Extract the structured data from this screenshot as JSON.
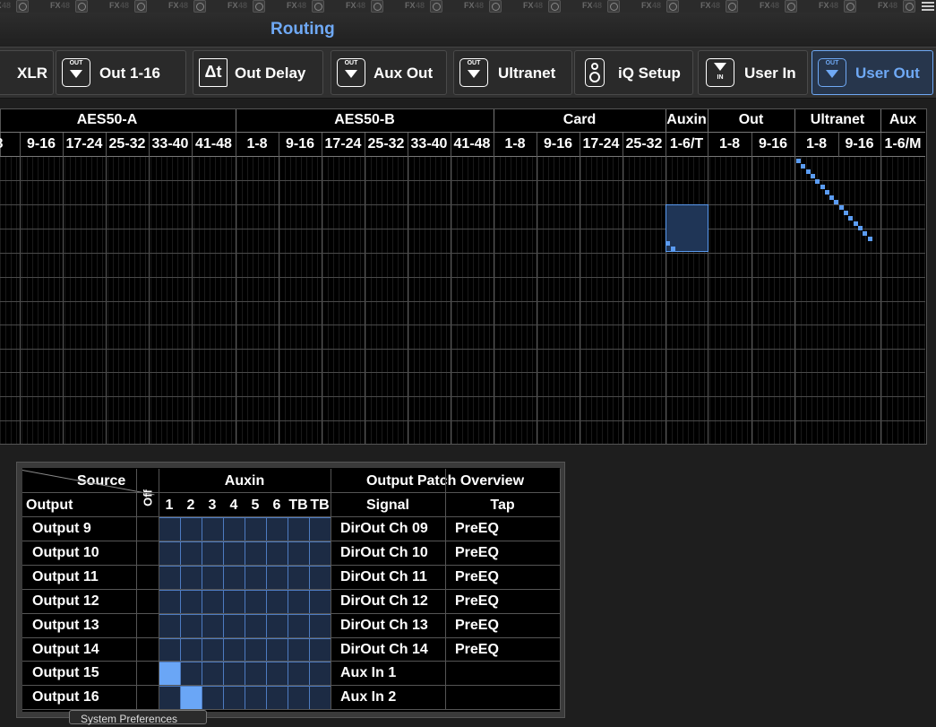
{
  "top_strip": {
    "fx_label": "FX",
    "fx_number": "48"
  },
  "title": "Routing",
  "tabs": [
    {
      "label": "XLR",
      "icon": "xlr-icon",
      "active": false
    },
    {
      "label": "Out 1-16",
      "icon": "out-icon",
      "active": false
    },
    {
      "label": "Out Delay",
      "icon": "delta-t-icon",
      "active": false
    },
    {
      "label": "Aux Out",
      "icon": "out-icon",
      "active": false
    },
    {
      "label": "Ultranet",
      "icon": "out-icon",
      "active": false
    },
    {
      "label": "iQ Setup",
      "icon": "speaker-icon",
      "active": false
    },
    {
      "label": "User In",
      "icon": "in-icon",
      "active": true
    },
    {
      "label": "User Out",
      "icon": "out-icon",
      "active": true
    }
  ],
  "icon_text": {
    "out": "OUT",
    "in": "IN",
    "delta": "Δt"
  },
  "matrix": {
    "groups": [
      "AES50-A",
      "AES50-B",
      "Card",
      "Auxin",
      "Out",
      "Ultranet",
      "Aux"
    ],
    "sub_headers": [
      "8",
      "9-16",
      "17-24",
      "25-32",
      "33-40",
      "41-48",
      "1-8",
      "9-16",
      "17-24",
      "25-32",
      "33-40",
      "41-48",
      "1-8",
      "9-16",
      "17-24",
      "25-32",
      "1-6/T",
      "1-8",
      "9-16",
      "1-8",
      "9-16",
      "1-6/M"
    ]
  },
  "panel": {
    "source_label": "Source",
    "output_label": "Output",
    "off_label": "Off",
    "auxin_label": "Auxin",
    "auxin_cols": [
      "1",
      "2",
      "3",
      "4",
      "5",
      "6",
      "TB",
      "TB"
    ],
    "overview_label": "Output  Patch Overview",
    "signal_label": "Signal",
    "tap_label": "Tap",
    "rows": [
      {
        "output": "Output 9",
        "signal": "DirOut Ch 09",
        "tap": "PreEQ",
        "sel": -1
      },
      {
        "output": "Output 10",
        "signal": "DirOut Ch 10",
        "tap": "PreEQ",
        "sel": -1
      },
      {
        "output": "Output 11",
        "signal": "DirOut Ch 11",
        "tap": "PreEQ",
        "sel": -1
      },
      {
        "output": "Output 12",
        "signal": "DirOut Ch 12",
        "tap": "PreEQ",
        "sel": -1
      },
      {
        "output": "Output 13",
        "signal": "DirOut Ch 13",
        "tap": "PreEQ",
        "sel": -1
      },
      {
        "output": "Output 14",
        "signal": "DirOut Ch 14",
        "tap": "PreEQ",
        "sel": -1
      },
      {
        "output": "Output 15",
        "signal": "Aux In 1",
        "tap": "",
        "sel": 0
      },
      {
        "output": "Output 16",
        "signal": "Aux In 2",
        "tap": "",
        "sel": 1
      }
    ]
  },
  "tooltip": "System Preferences"
}
